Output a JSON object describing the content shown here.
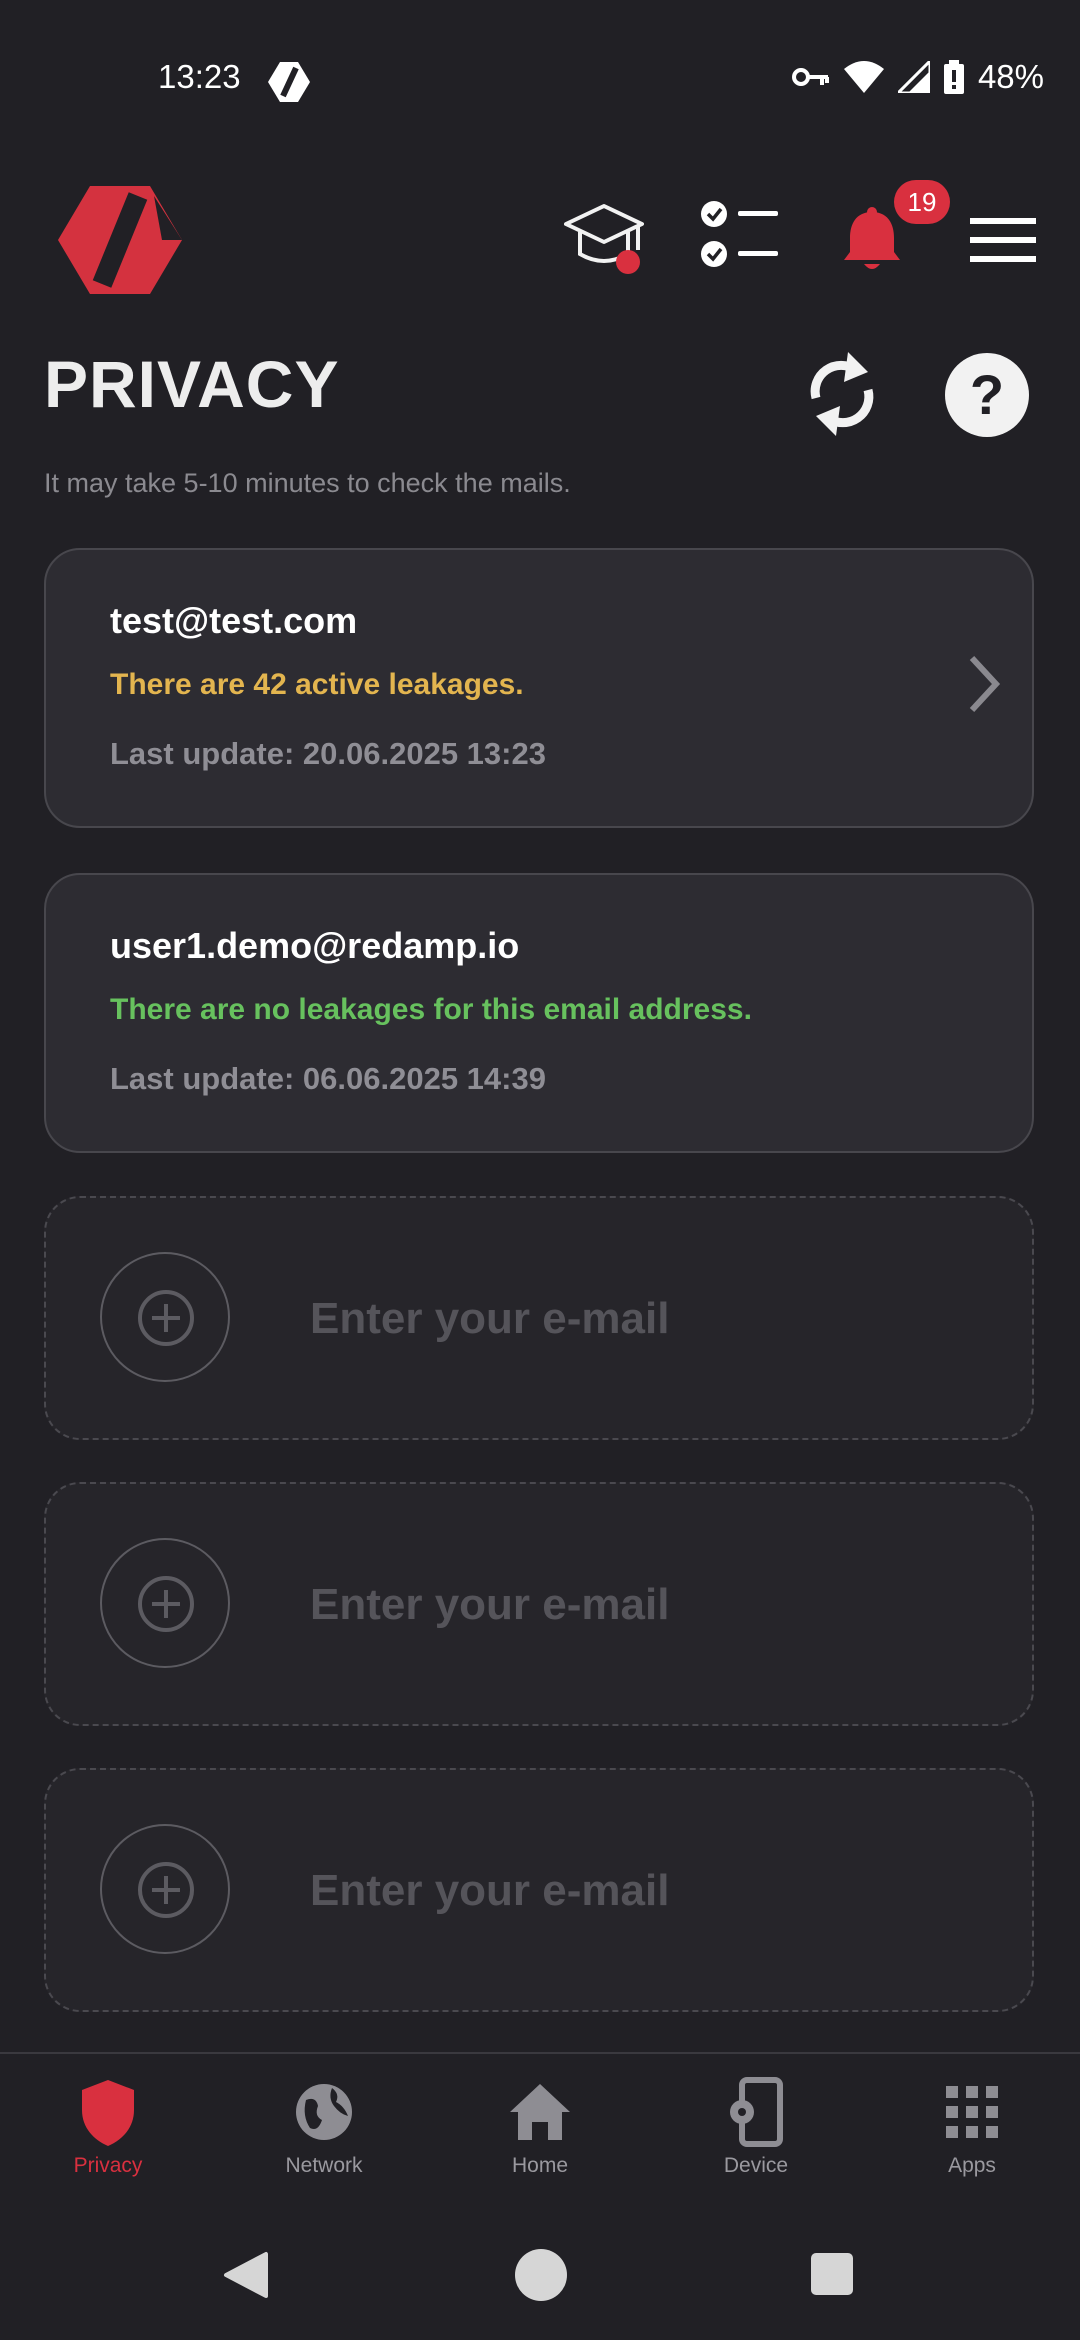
{
  "status_bar": {
    "time": "13:23",
    "battery": "48%"
  },
  "header": {
    "notification_count": "19"
  },
  "page": {
    "title": "PRIVACY",
    "subtitle": "It may take 5-10 minutes to check the mails."
  },
  "emails": [
    {
      "address": "test@test.com",
      "status": "There are 42 active leakages.",
      "updated": "Last update: 20.06.2025 13:23"
    },
    {
      "address": "user1.demo@redamp.io",
      "status": "There are no leakages for this email address.",
      "updated": "Last update: 06.06.2025 14:39"
    }
  ],
  "add_email": {
    "placeholder": "Enter your e-mail"
  },
  "nav": {
    "items": [
      {
        "label": "Privacy",
        "icon": "shield-icon"
      },
      {
        "label": "Network",
        "icon": "globe-icon"
      },
      {
        "label": "Home",
        "icon": "home-icon"
      },
      {
        "label": "Device",
        "icon": "device-settings-icon"
      },
      {
        "label": "Apps",
        "icon": "apps-grid-icon"
      }
    ]
  },
  "colors": {
    "accent": "#d9303f",
    "warning": "#e3b54f",
    "success": "#67c15e"
  }
}
